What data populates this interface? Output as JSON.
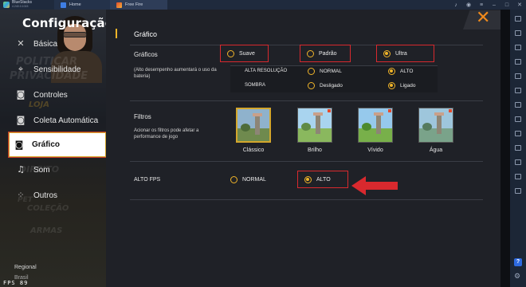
{
  "titlebar": {
    "brand": "BlueStacks",
    "brand_sub": "4.240.0.1015",
    "tabs": [
      {
        "label": "Home"
      },
      {
        "label": "Free Fire"
      }
    ]
  },
  "sidebar": {
    "title": "Configuração",
    "items": [
      {
        "label": "Básica",
        "icon": "tools-icon"
      },
      {
        "label": "Sensibilidade",
        "icon": "crosshair-icon"
      },
      {
        "label": "Controles",
        "icon": "gamepad-icon"
      },
      {
        "label": "Coleta Automática",
        "icon": "gamepad-icon"
      },
      {
        "label": "Gráfico",
        "icon": "gamepad-icon",
        "active": true
      },
      {
        "label": "Som",
        "icon": "music-icon"
      },
      {
        "label": "Outros",
        "icon": "dots-icon"
      }
    ],
    "background_text": [
      "POLITICAR",
      "PRIVACIDADE",
      "LOJA",
      "DIREITO",
      "PET",
      "COLEÇÃO",
      "ARMAS"
    ],
    "region_label": "Regional",
    "region_value": "Brasil",
    "fps_readout": "FPS 89"
  },
  "panel": {
    "section_title": "Gráfico",
    "graficos": {
      "label": "Gráficos",
      "note": "(Alto desempenho aumentará o uso da bateria)",
      "options": [
        {
          "label": "Suave",
          "selected": false
        },
        {
          "label": "Padrão",
          "selected": false
        },
        {
          "label": "Ultra",
          "selected": true
        }
      ]
    },
    "sub_settings": [
      {
        "label": "ALTA RESOLUÇÃO",
        "options": [
          {
            "label": "NORMAL",
            "selected": false
          },
          {
            "label": "ALTO",
            "selected": true
          }
        ]
      },
      {
        "label": "SOMBRA",
        "options": [
          {
            "label": "Desligado",
            "selected": false
          },
          {
            "label": "Ligado",
            "selected": true
          }
        ]
      }
    ],
    "filtros": {
      "label": "Filtros",
      "note": "Acionar os filtros pode afetar a performance de jogo",
      "items": [
        {
          "label": "Clássico",
          "selected": true
        },
        {
          "label": "Brilho",
          "selected": false
        },
        {
          "label": "Vívido",
          "selected": false
        },
        {
          "label": "Água",
          "selected": false
        }
      ]
    },
    "alto_fps": {
      "label": "ALTO FPS",
      "options": [
        {
          "label": "NORMAL",
          "selected": false
        },
        {
          "label": "ALTO",
          "selected": true
        }
      ]
    }
  },
  "colors": {
    "accent": "#f0b429",
    "highlight_box": "#d9292e",
    "close": "#f08a1c"
  }
}
